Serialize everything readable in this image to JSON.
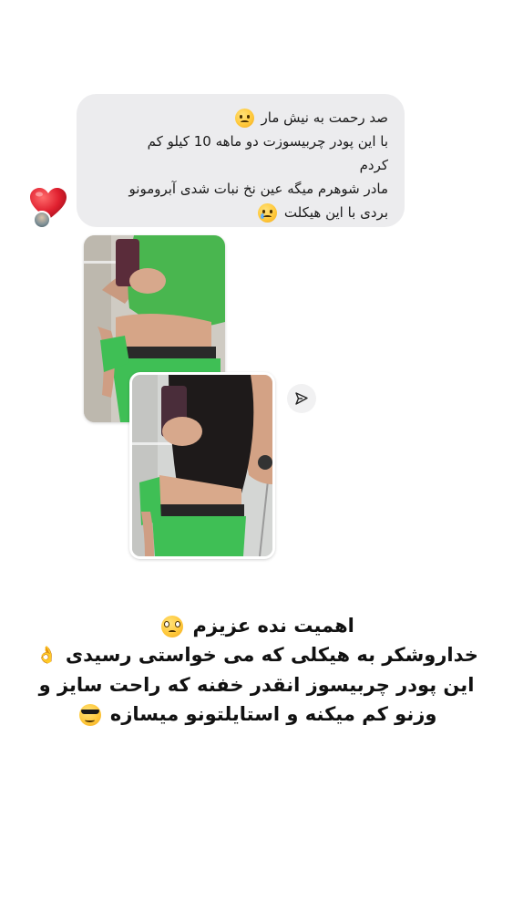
{
  "message": {
    "lines": [
      "صد رحمت به نیش مار",
      "با این پودر چربیسوزت دو ماهه 10 کیلو کم",
      "کردم",
      "مادر شوهرم میگه عین نخ نبات شدی آبرومونو",
      "بردی با این هیکلت"
    ],
    "reaction_icon": "red-heart",
    "emoji_line1": "unamused-face",
    "emoji_line5": "crying-face"
  },
  "share_icon": "paper-plane",
  "caption": {
    "lines": [
      "اهمیت نده عزیزم",
      "خداروشکر به هیکلی که می خواستی رسیدی",
      "این پودر چربیسوز انقدر خفنه که راحت سایز و",
      "وزنو کم میکنه و استایلتونو میسازه"
    ],
    "emoji_line1": "pleading-face",
    "emoji_line2": "ok-hand",
    "emoji_line4": "sunglasses-face"
  },
  "colors": {
    "bubble": "#ececee",
    "heart": "#e0202f",
    "pants": "#3fbf55"
  }
}
